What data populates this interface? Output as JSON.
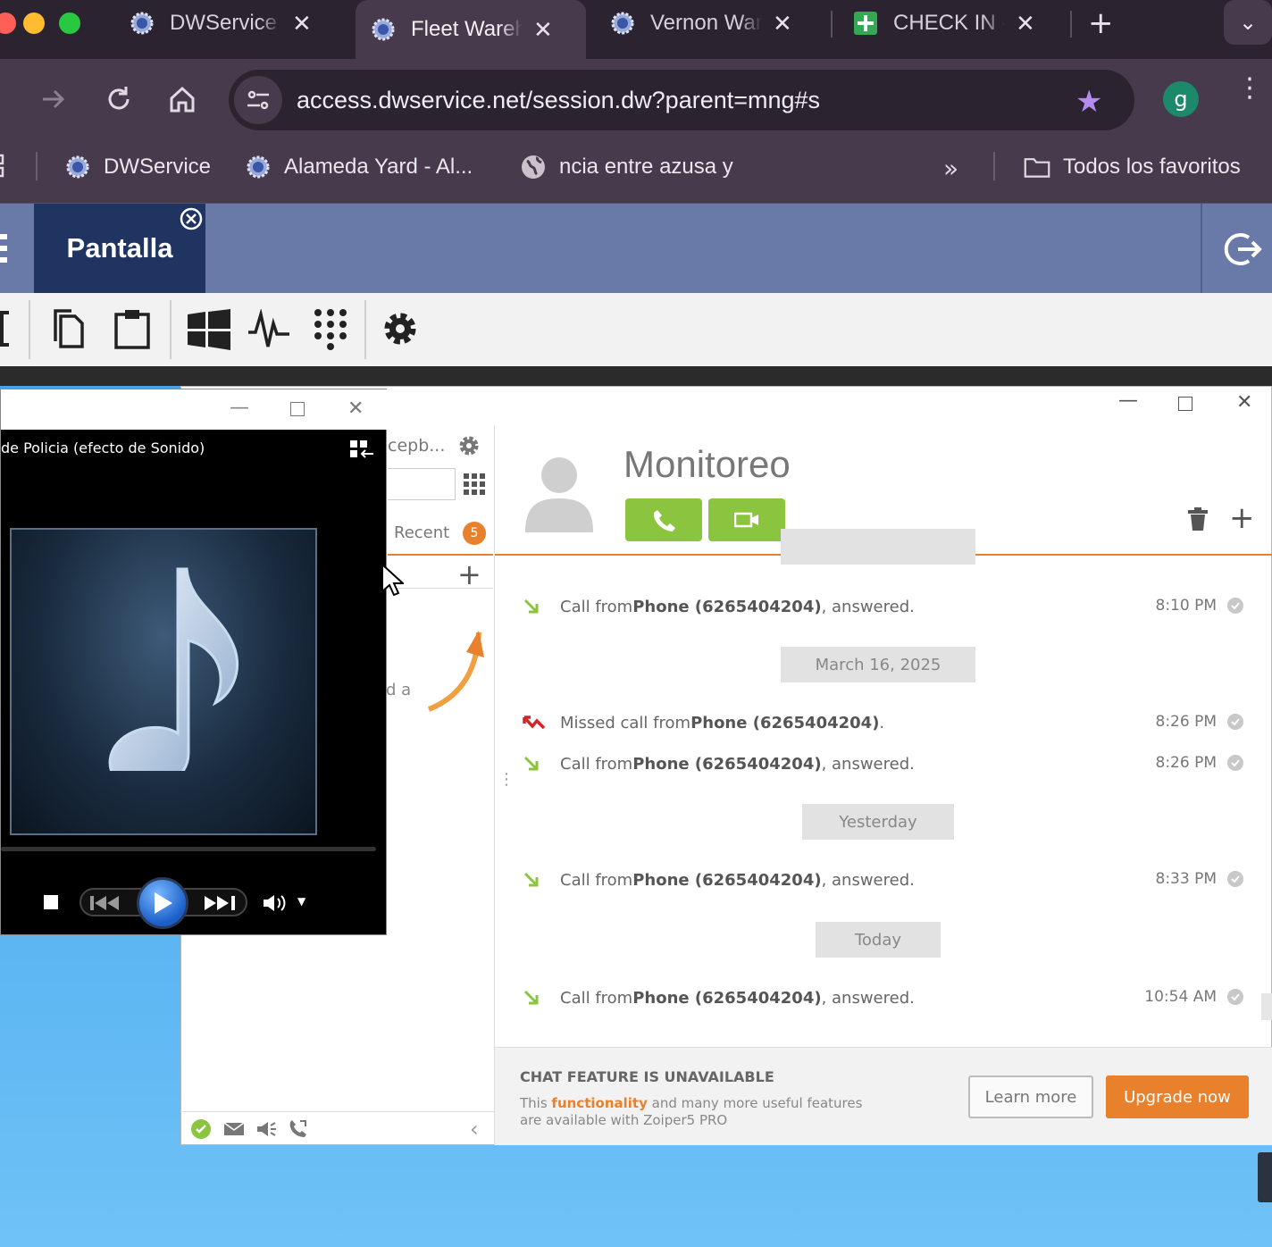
{
  "browser": {
    "tabs": [
      {
        "title": "DWService",
        "active": false,
        "icon": "gear-globe-icon"
      },
      {
        "title": "Fleet Wareh",
        "active": true,
        "icon": "gear-globe-icon"
      },
      {
        "title": "Vernon War",
        "active": false,
        "icon": "gear-globe-icon"
      },
      {
        "title": "CHECK IN -",
        "active": false,
        "icon": "sheets-plus-icon"
      }
    ],
    "url": "access.dwservice.net/session.dw?parent=mng#s",
    "profile_initial": "g",
    "bookmarks": [
      {
        "label": "DWService",
        "icon": "gear-globe-icon"
      },
      {
        "label": "Alameda Yard - Al...",
        "icon": "gear-globe-icon"
      },
      {
        "label": "ncia entre azusa y",
        "icon": "globe-icon"
      }
    ],
    "all_bookmarks_label": "Todos los favoritos"
  },
  "dwservice": {
    "tab_label": "Pantalla"
  },
  "player": {
    "track_title": "de Policia (efecto de Sonido)"
  },
  "zoiper": {
    "contact_name": "Monitoreo",
    "sidebar": {
      "account_label": "cepb...",
      "recent_label": "Recent",
      "recent_count": "5",
      "partial_text": "d a"
    },
    "history": [
      {
        "kind": "separator",
        "text": ""
      },
      {
        "kind": "call",
        "type": "answered",
        "prefix": "Call from ",
        "name": "Phone (6265404204)",
        "suffix": ", answered.",
        "time": "8:10 PM"
      },
      {
        "kind": "separator",
        "text": "March 16, 2025"
      },
      {
        "kind": "call",
        "type": "missed",
        "prefix": "Missed call from ",
        "name": "Phone (6265404204)",
        "suffix": ".",
        "time": "8:26 PM"
      },
      {
        "kind": "call",
        "type": "answered",
        "prefix": "Call from ",
        "name": "Phone (6265404204)",
        "suffix": ", answered.",
        "time": "8:26 PM"
      },
      {
        "kind": "separator",
        "text": "Yesterday"
      },
      {
        "kind": "call",
        "type": "answered",
        "prefix": "Call from ",
        "name": "Phone (6265404204)",
        "suffix": ", answered.",
        "time": "8:33 PM"
      },
      {
        "kind": "separator",
        "text": "Today"
      },
      {
        "kind": "call",
        "type": "answered",
        "prefix": "Call from ",
        "name": "Phone (6265404204)",
        "suffix": ", answered.",
        "time": "10:54 AM"
      }
    ],
    "chat_banner": {
      "heading": "CHAT FEATURE IS UNAVAILABLE",
      "line1_pre": "This ",
      "line1_highlight": "functionality",
      "line1_post": " and many more useful features",
      "line2": "are available with Zoiper5 PRO",
      "learn_more": "Learn more",
      "upgrade": "Upgrade now"
    }
  },
  "colors": {
    "accent_orange": "#e9802c",
    "call_green": "#8bc53f",
    "missed_red": "#d0262e",
    "dw_blue": "#1f3460"
  }
}
